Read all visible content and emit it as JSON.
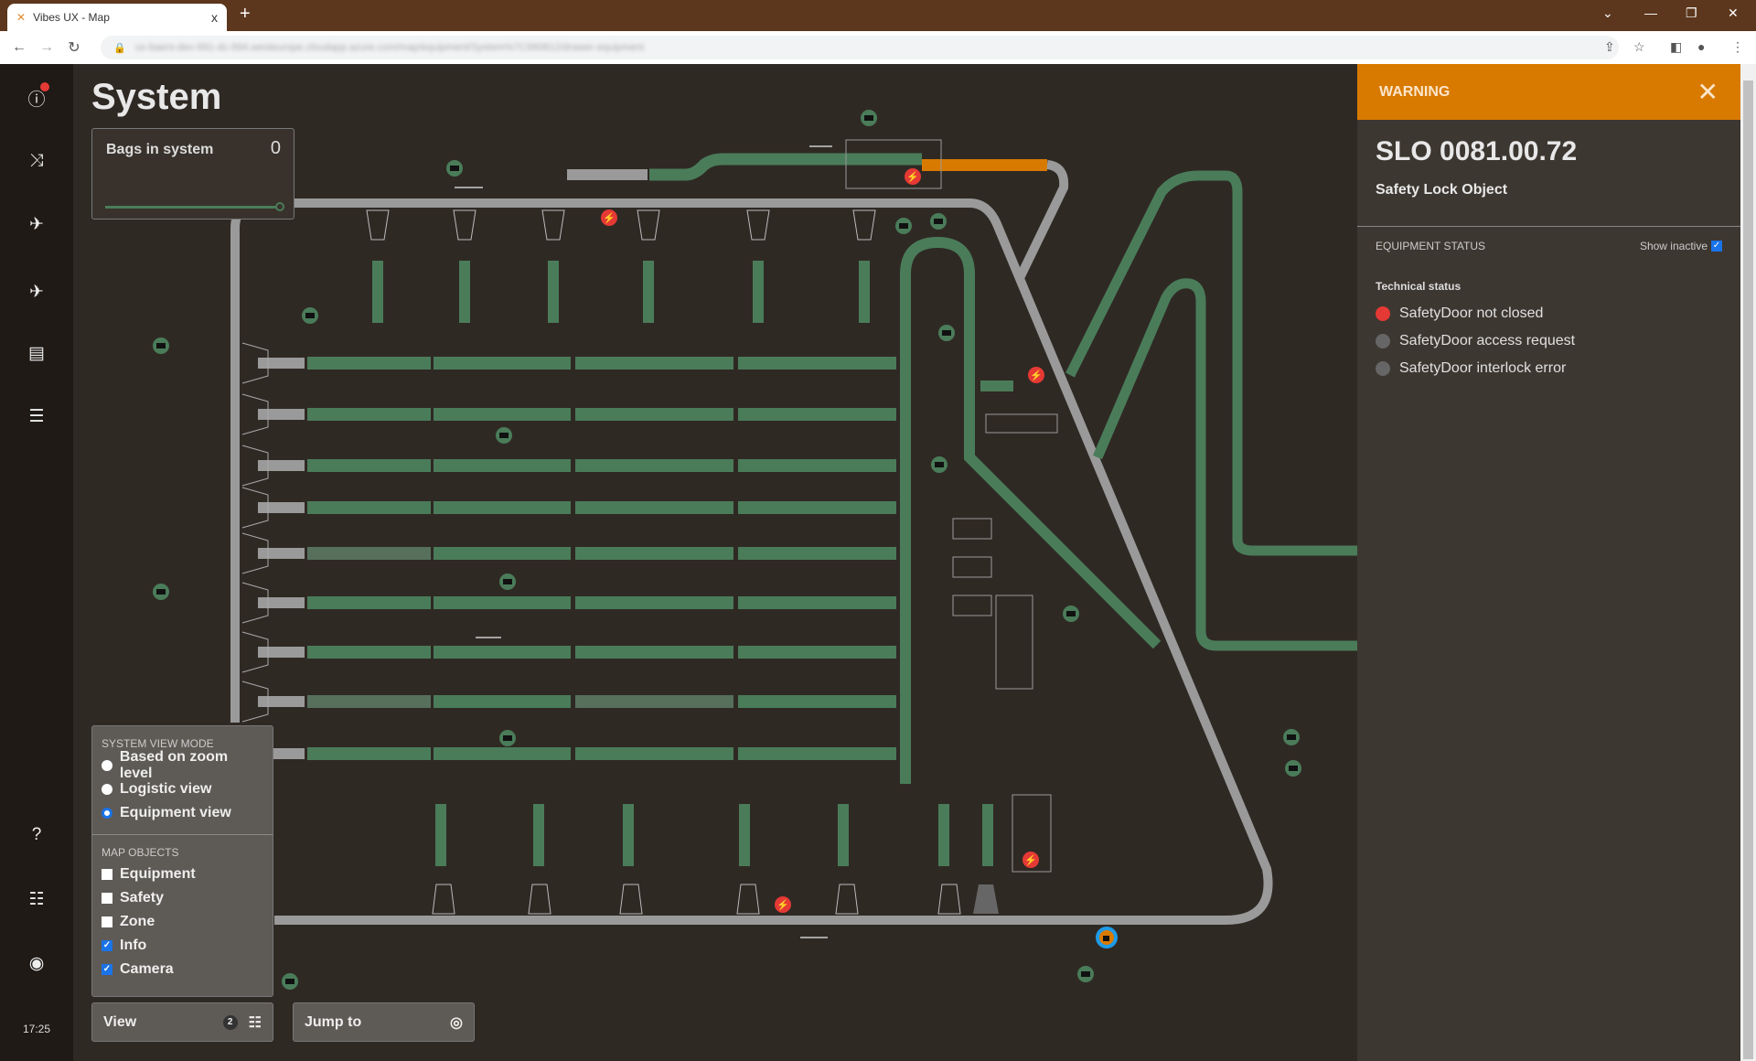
{
  "browser": {
    "tab_title": "Vibes UX - Map",
    "tab_close": "x",
    "new_tab": "+",
    "url": "ux-baers-dev-991-dc-994.westeurope.cloudapp.azure.com/map/equipment/System%7C990812/drawer-equipment",
    "window_controls": [
      "⌄",
      "—",
      "❐",
      "✕"
    ]
  },
  "sidebar": {
    "items": [
      "alerts-icon",
      "routing-icon",
      "departures-icon",
      "arrivals-icon",
      "carts-icon",
      "reports-icon"
    ],
    "bottom": [
      "help-icon",
      "settings-icon",
      "account-icon"
    ],
    "time": "17:25",
    "alert_badge_color": "#e53935"
  },
  "map": {
    "title": "System",
    "bags": {
      "label": "Bags in system",
      "value": "0"
    },
    "colors": {
      "conveyor_active": "#4a7c59",
      "conveyor_idle": "#9a9a9a",
      "warning": "#d97a00",
      "error": "#e53935",
      "selected": "#1e9be8"
    }
  },
  "view_panel": {
    "mode_header": "SYSTEM VIEW MODE",
    "modes": [
      {
        "label": "Based on zoom level",
        "selected": false
      },
      {
        "label": "Logistic view",
        "selected": false
      },
      {
        "label": "Equipment view",
        "selected": true
      }
    ],
    "objects_header": "MAP OBJECTS",
    "objects": [
      {
        "label": "Equipment",
        "checked": false
      },
      {
        "label": "Safety",
        "checked": false
      },
      {
        "label": "Zone",
        "checked": false
      },
      {
        "label": "Info",
        "checked": true
      },
      {
        "label": "Camera",
        "checked": true
      }
    ]
  },
  "view_button": {
    "label": "View",
    "count": "2"
  },
  "jump_button": {
    "label": "Jump to"
  },
  "detail": {
    "severity": "WARNING",
    "id": "SLO 0081.00.72",
    "type": "Safety Lock Object",
    "section": "EQUIPMENT STATUS",
    "show_inactive": "Show inactive",
    "show_inactive_checked": true,
    "group": "Technical status",
    "statuses": [
      {
        "label": "SafetyDoor not closed",
        "color": "#e53935"
      },
      {
        "label": "SafetyDoor access request",
        "color": "#666666"
      },
      {
        "label": "SafetyDoor interlock error",
        "color": "#666666"
      }
    ]
  }
}
